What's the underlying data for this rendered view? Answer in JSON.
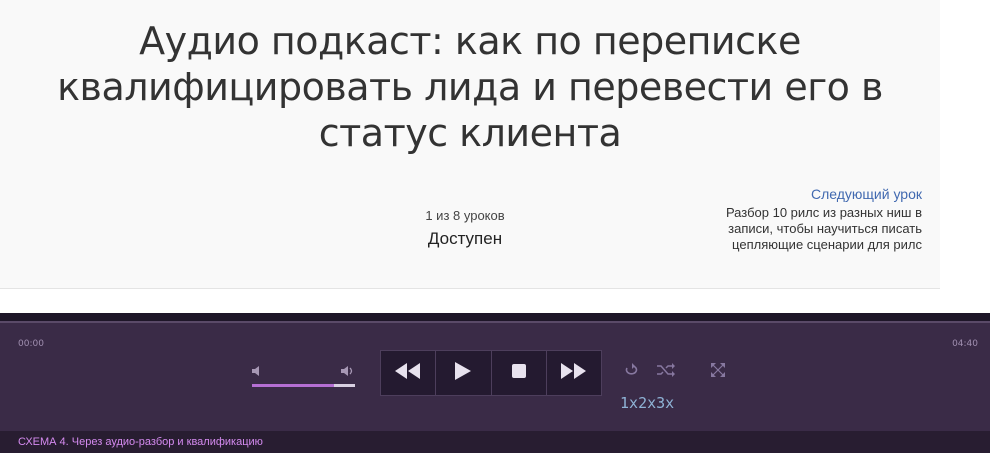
{
  "lesson": {
    "title": "Аудио подкаст: как по переписке квалифицировать лида и перевести его в статус клиента",
    "count": "1 из 8 уроков",
    "status": "Доступен",
    "next_label": "Следующий урок",
    "next_title": "Разбор 10 рилс из разных ниш в записи, чтобы научиться писать цепляющие сценарии для рилс"
  },
  "player": {
    "time_current": "00:00",
    "time_total": "04:40",
    "volume_level": 0.8,
    "speeds": [
      "1x",
      "2x",
      "3x"
    ],
    "track_title": "СХЕМА 4. Через аудио-разбор и квалификацию",
    "colors": {
      "background": "#3a2b47",
      "accent": "#b56fd4",
      "track_text": "#d58bf0",
      "speed_text": "#8fb3d6"
    },
    "icons": [
      "rewind-icon",
      "play-icon",
      "stop-icon",
      "fast-forward-icon",
      "repeat-icon",
      "shuffle-icon",
      "expand-icon",
      "volume-low-icon",
      "volume-high-icon"
    ]
  }
}
